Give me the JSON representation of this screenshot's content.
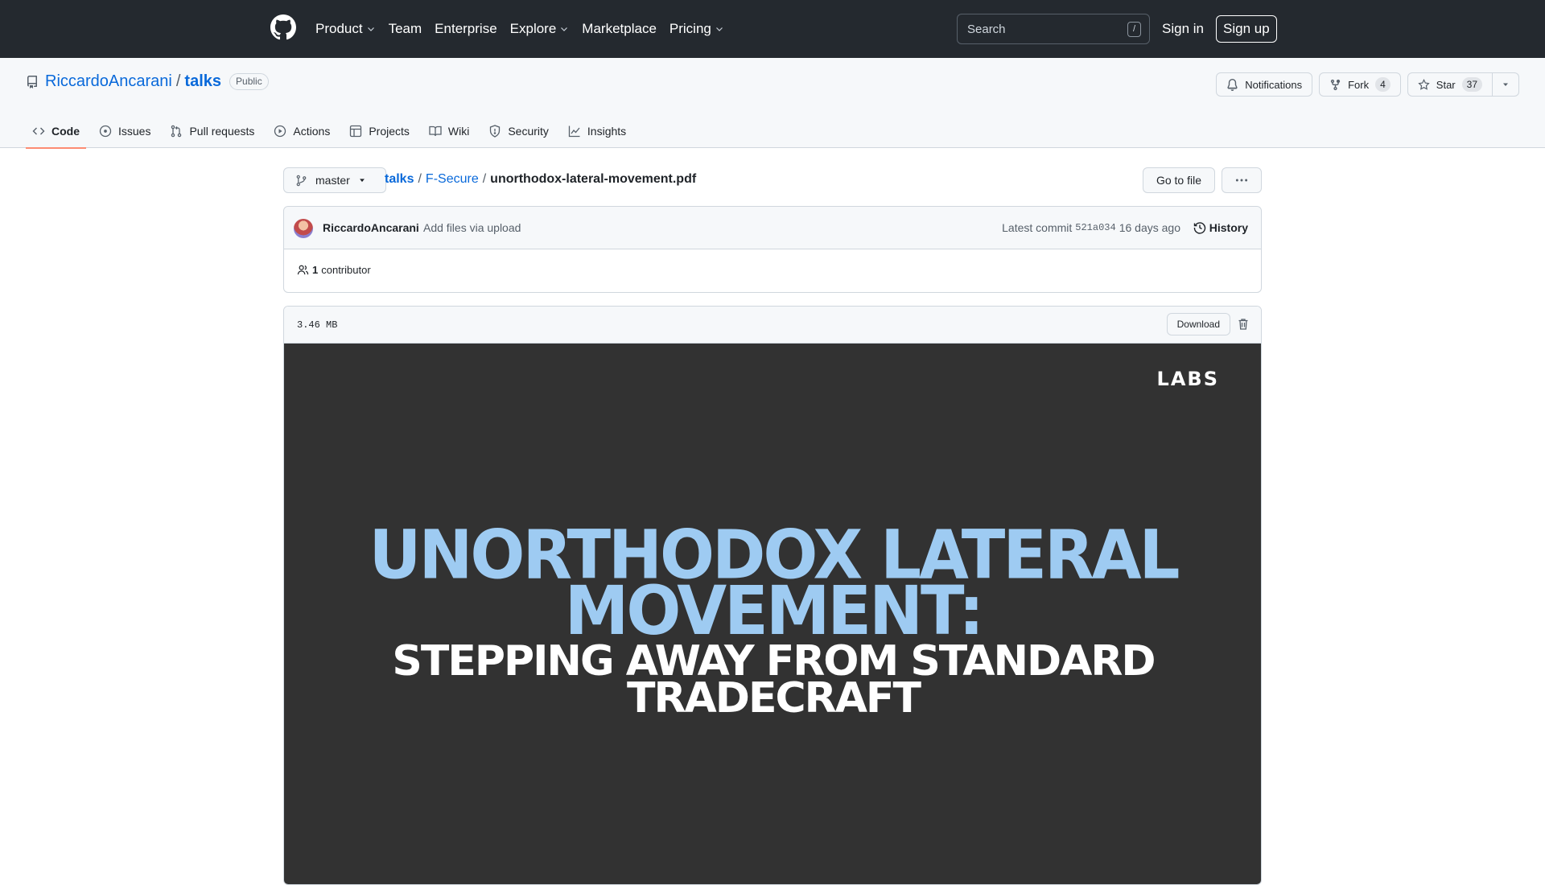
{
  "header": {
    "nav": [
      {
        "label": "Product",
        "dropdown": true
      },
      {
        "label": "Team",
        "dropdown": false
      },
      {
        "label": "Enterprise",
        "dropdown": false
      },
      {
        "label": "Explore",
        "dropdown": true
      },
      {
        "label": "Marketplace",
        "dropdown": false
      },
      {
        "label": "Pricing",
        "dropdown": true
      }
    ],
    "search_placeholder": "Search",
    "search_shortcut": "/",
    "sign_in": "Sign in",
    "sign_up": "Sign up"
  },
  "repo": {
    "owner": "RiccardoAncarani",
    "separator": "/",
    "name": "talks",
    "visibility": "Public",
    "notifications_label": "Notifications",
    "fork_label": "Fork",
    "fork_count": "4",
    "star_label": "Star",
    "star_count": "37",
    "tabs": [
      {
        "label": "Code",
        "icon": "code-icon",
        "active": true
      },
      {
        "label": "Issues",
        "icon": "issue-icon",
        "active": false
      },
      {
        "label": "Pull requests",
        "icon": "pull-request-icon",
        "active": false
      },
      {
        "label": "Actions",
        "icon": "play-icon",
        "active": false
      },
      {
        "label": "Projects",
        "icon": "table-icon",
        "active": false
      },
      {
        "label": "Wiki",
        "icon": "book-icon",
        "active": false
      },
      {
        "label": "Security",
        "icon": "shield-icon",
        "active": false
      },
      {
        "label": "Insights",
        "icon": "graph-icon",
        "active": false
      }
    ]
  },
  "path": {
    "branch": "master",
    "crumbs": [
      "talks",
      "F-Secure"
    ],
    "separator": "/",
    "file": "unorthodox-lateral-movement.pdf",
    "go_to_file": "Go to file"
  },
  "commit": {
    "author": "RiccardoAncarani",
    "message": "Add files via upload",
    "latest_label": "Latest commit",
    "sha": "521a034",
    "time": "16 days ago",
    "history_label": "History",
    "contributors_count": "1",
    "contributors_label": "contributor"
  },
  "file": {
    "size": "3.46 MB",
    "download_label": "Download",
    "slide": {
      "logo": "LABS",
      "title_line1": "UNORTHODOX LATERAL",
      "title_line2": "MOVEMENT:",
      "subtitle_line1": "STEPPING AWAY FROM STANDARD",
      "subtitle_line2": "TRADECRAFT"
    }
  },
  "colors": {
    "header_bg": "#24292f",
    "link": "#0969da",
    "active_tab_underline": "#fd8c73",
    "slide_bg": "#323232",
    "slide_title": "#9ecbf2"
  }
}
